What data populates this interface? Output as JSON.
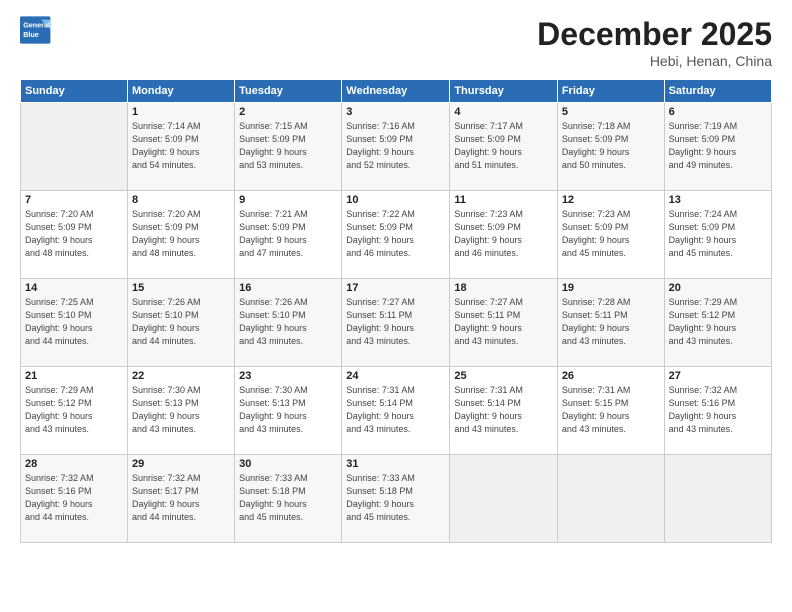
{
  "logo": {
    "line1": "General",
    "line2": "Blue"
  },
  "title": "December 2025",
  "subtitle": "Hebi, Henan, China",
  "days_header": [
    "Sunday",
    "Monday",
    "Tuesday",
    "Wednesday",
    "Thursday",
    "Friday",
    "Saturday"
  ],
  "weeks": [
    [
      {
        "day": "",
        "info": ""
      },
      {
        "day": "1",
        "info": "Sunrise: 7:14 AM\nSunset: 5:09 PM\nDaylight: 9 hours\nand 54 minutes."
      },
      {
        "day": "2",
        "info": "Sunrise: 7:15 AM\nSunset: 5:09 PM\nDaylight: 9 hours\nand 53 minutes."
      },
      {
        "day": "3",
        "info": "Sunrise: 7:16 AM\nSunset: 5:09 PM\nDaylight: 9 hours\nand 52 minutes."
      },
      {
        "day": "4",
        "info": "Sunrise: 7:17 AM\nSunset: 5:09 PM\nDaylight: 9 hours\nand 51 minutes."
      },
      {
        "day": "5",
        "info": "Sunrise: 7:18 AM\nSunset: 5:09 PM\nDaylight: 9 hours\nand 50 minutes."
      },
      {
        "day": "6",
        "info": "Sunrise: 7:19 AM\nSunset: 5:09 PM\nDaylight: 9 hours\nand 49 minutes."
      }
    ],
    [
      {
        "day": "7",
        "info": "Sunrise: 7:20 AM\nSunset: 5:09 PM\nDaylight: 9 hours\nand 48 minutes."
      },
      {
        "day": "8",
        "info": "Sunrise: 7:20 AM\nSunset: 5:09 PM\nDaylight: 9 hours\nand 48 minutes."
      },
      {
        "day": "9",
        "info": "Sunrise: 7:21 AM\nSunset: 5:09 PM\nDaylight: 9 hours\nand 47 minutes."
      },
      {
        "day": "10",
        "info": "Sunrise: 7:22 AM\nSunset: 5:09 PM\nDaylight: 9 hours\nand 46 minutes."
      },
      {
        "day": "11",
        "info": "Sunrise: 7:23 AM\nSunset: 5:09 PM\nDaylight: 9 hours\nand 46 minutes."
      },
      {
        "day": "12",
        "info": "Sunrise: 7:23 AM\nSunset: 5:09 PM\nDaylight: 9 hours\nand 45 minutes."
      },
      {
        "day": "13",
        "info": "Sunrise: 7:24 AM\nSunset: 5:09 PM\nDaylight: 9 hours\nand 45 minutes."
      }
    ],
    [
      {
        "day": "14",
        "info": "Sunrise: 7:25 AM\nSunset: 5:10 PM\nDaylight: 9 hours\nand 44 minutes."
      },
      {
        "day": "15",
        "info": "Sunrise: 7:26 AM\nSunset: 5:10 PM\nDaylight: 9 hours\nand 44 minutes."
      },
      {
        "day": "16",
        "info": "Sunrise: 7:26 AM\nSunset: 5:10 PM\nDaylight: 9 hours\nand 43 minutes."
      },
      {
        "day": "17",
        "info": "Sunrise: 7:27 AM\nSunset: 5:11 PM\nDaylight: 9 hours\nand 43 minutes."
      },
      {
        "day": "18",
        "info": "Sunrise: 7:27 AM\nSunset: 5:11 PM\nDaylight: 9 hours\nand 43 minutes."
      },
      {
        "day": "19",
        "info": "Sunrise: 7:28 AM\nSunset: 5:11 PM\nDaylight: 9 hours\nand 43 minutes."
      },
      {
        "day": "20",
        "info": "Sunrise: 7:29 AM\nSunset: 5:12 PM\nDaylight: 9 hours\nand 43 minutes."
      }
    ],
    [
      {
        "day": "21",
        "info": "Sunrise: 7:29 AM\nSunset: 5:12 PM\nDaylight: 9 hours\nand 43 minutes."
      },
      {
        "day": "22",
        "info": "Sunrise: 7:30 AM\nSunset: 5:13 PM\nDaylight: 9 hours\nand 43 minutes."
      },
      {
        "day": "23",
        "info": "Sunrise: 7:30 AM\nSunset: 5:13 PM\nDaylight: 9 hours\nand 43 minutes."
      },
      {
        "day": "24",
        "info": "Sunrise: 7:31 AM\nSunset: 5:14 PM\nDaylight: 9 hours\nand 43 minutes."
      },
      {
        "day": "25",
        "info": "Sunrise: 7:31 AM\nSunset: 5:14 PM\nDaylight: 9 hours\nand 43 minutes."
      },
      {
        "day": "26",
        "info": "Sunrise: 7:31 AM\nSunset: 5:15 PM\nDaylight: 9 hours\nand 43 minutes."
      },
      {
        "day": "27",
        "info": "Sunrise: 7:32 AM\nSunset: 5:16 PM\nDaylight: 9 hours\nand 43 minutes."
      }
    ],
    [
      {
        "day": "28",
        "info": "Sunrise: 7:32 AM\nSunset: 5:16 PM\nDaylight: 9 hours\nand 44 minutes."
      },
      {
        "day": "29",
        "info": "Sunrise: 7:32 AM\nSunset: 5:17 PM\nDaylight: 9 hours\nand 44 minutes."
      },
      {
        "day": "30",
        "info": "Sunrise: 7:33 AM\nSunset: 5:18 PM\nDaylight: 9 hours\nand 45 minutes."
      },
      {
        "day": "31",
        "info": "Sunrise: 7:33 AM\nSunset: 5:18 PM\nDaylight: 9 hours\nand 45 minutes."
      },
      {
        "day": "",
        "info": ""
      },
      {
        "day": "",
        "info": ""
      },
      {
        "day": "",
        "info": ""
      }
    ]
  ]
}
